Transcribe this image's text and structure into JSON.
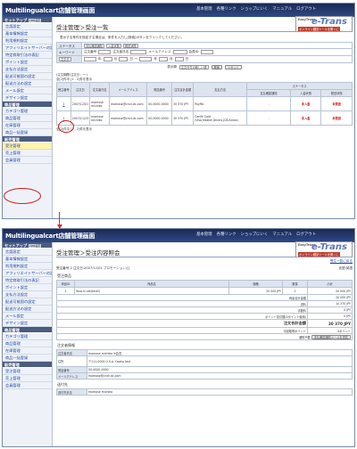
{
  "header": {
    "title": "Multilingualcart店舗管理画面",
    "nav": [
      "基本管理",
      "各種リンク",
      "ショップにいく",
      "マニュアル",
      "ログアウト"
    ]
  },
  "logo": {
    "small": "EasyTrans",
    "main": "e-Trans",
    "tag": "オンライン翻訳ツールを開くに"
  },
  "sidebar": {
    "setup_section": "セットアップ",
    "setup_tiny": "LINK設定",
    "setup_items": [
      "言語設定",
      "基本情報設定",
      "利用規約設定",
      "アフィリエイトサーバーの設定",
      "特定商取引法の表記",
      "ポイント設定",
      "支払方法設定",
      "配送可能国の設定",
      "配送方法の設定",
      "メール設定",
      "デザイン設定"
    ],
    "product_section": "商品管理",
    "product_items": [
      "カテゴリ管理",
      "商品管理",
      "在庫管理",
      "商品一括登録"
    ],
    "sales_section": "販売管理",
    "sales_items": [
      "受注管理",
      "売上管理",
      "会員管理"
    ]
  },
  "list": {
    "page_title": "受注管理＞受注一覧",
    "instruction": "表示する条件を指定する場合は、条件を入力し[検索]ボタンをクリックしてください。",
    "status_label": "ステータス",
    "status_values": [
      "支払確認通知",
      "入金状態",
      "発送状態"
    ],
    "keyword_label": "キーワード",
    "keyword_fields": [
      "注文番号",
      "注文者氏名",
      "メールアドレス",
      "会員ID"
    ],
    "date_label": "注文日",
    "date_units": [
      "年",
      "月",
      "日",
      "年",
      "月",
      "日"
    ],
    "date_prefix": "～",
    "sort_label": "表示順",
    "sort_value": "注文日付の新しい順",
    "search_button": "検索",
    "reset_button": "リセット",
    "period_text": "(注文期間:注文日 : ～ )",
    "count_text": "全[2]件中 [1 - 2]件を表示",
    "columns": [
      "受注番号",
      "注文日",
      "注文者氏名",
      "メールアドレス",
      "電話番号",
      "注文合計金額",
      "支払方法",
      "支払確認通知",
      "入金状態",
      "発送状態"
    ],
    "status_header": "ステータス",
    "rows": [
      {
        "id": "2",
        "date": "2007/12/01",
        "name": "momose michiko",
        "email": "momose@cnct-dc.com",
        "phone": "00-0000-0000",
        "total": "30 370 JPY",
        "method": "PayPal",
        "notify": "-",
        "paid": "未入金",
        "shipped": "未発送"
      },
      {
        "id": "1",
        "date": "2007/11/23",
        "name": "momose michiko",
        "email": "momose@cnct-dc.com",
        "phone": "00-0000-0000",
        "total": "30 370 JPY",
        "method": "Cardit Card (Visa,Master,Diners,JCB,Amex)",
        "notify": "-",
        "paid": "未入金",
        "shipped": "未発送"
      }
    ],
    "count_text_bottom": "全[2]件中 [1 - 2]件を表示"
  },
  "detail": {
    "page_title": "受注管理＞受注内容照会",
    "back_link": "受注一覧に戻る",
    "order_line": "受注番号:2 注文日:2007/12/01 プロモーション:[]",
    "language_label": "言語:英語",
    "items_title": "受注商品",
    "item_columns": [
      "商品ID",
      "商品名",
      "価格",
      "数量",
      "小計"
    ],
    "item_row": {
      "id": "2",
      "name": "Toso-ki set(test2)",
      "price": "20 000 JPY",
      "qty": "1",
      "subtotal": "20 000 JPY"
    },
    "totals": [
      {
        "label": "商品合計金額",
        "value": "20 000 JPY"
      },
      {
        "label": "送料",
        "value": "10 370 JPY"
      },
      {
        "label": "手数料",
        "value": "0 JPY"
      },
      {
        "label": "ポイント割引額(0ポイント使用)",
        "value": "0 JPY"
      }
    ],
    "grand_total_label": "注文合計金額",
    "grand_total_value": "30 370 JPY",
    "points_label": "今回取得ポイント",
    "points_value": "0ポイント",
    "notify_label": "通知不要",
    "notify_button": "支払確認通知メールを送信",
    "customer_title": "注文者情報",
    "customer_rows": [
      {
        "k": "注文者氏名",
        "v": "momose  michiko   ※会員"
      },
      {
        "k": "住所",
        "v": "〒111-0000  U.S.A.  Osaka test"
      },
      {
        "k": "電話番号",
        "v": "00-0000-0000"
      },
      {
        "k": "メールアドレス",
        "v": "momose@cnct-dc.com"
      }
    ],
    "shipping_title": "送付先",
    "shipping_first_key": "送付先氏名",
    "shipping_first_value": "momose  michiko"
  }
}
